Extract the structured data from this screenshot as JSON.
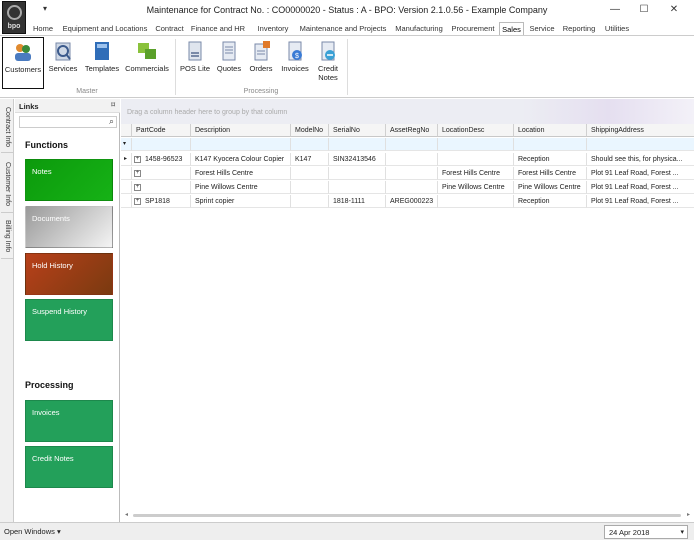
{
  "window": {
    "title": "Maintenance for Contract No. : CO0000020 - Status : A - BPO: Version 2.1.0.56 - Example Company",
    "logo_text": "bpo",
    "qat_glyph": "▾",
    "minimize_glyph": "—",
    "maximize_glyph": "☐",
    "close_glyph": "✕"
  },
  "ribbon_tabs": [
    "Home",
    "Equipment and Locations",
    "Contract",
    "Finance and HR",
    "Inventory",
    "Maintenance and Projects",
    "Manufacturing",
    "Procurement",
    "Sales",
    "Service",
    "Reporting",
    "Utilities"
  ],
  "ribbon_active_tab": "Sales",
  "ribbon": {
    "master": {
      "label": "Master",
      "buttons": [
        "Customers",
        "Services",
        "Templates",
        "Commercials"
      ]
    },
    "processing": {
      "label": "Processing",
      "buttons": [
        "POS Lite",
        "Quotes",
        "Orders",
        "Invoices",
        "Credit Notes"
      ]
    }
  },
  "side_tabs": [
    "Contract Info",
    "Customer Info",
    "Billing Info"
  ],
  "links": {
    "header": "Links",
    "pin_glyph": "⌑",
    "search_glyph": "⌕",
    "functions_title": "Functions",
    "functions": [
      "Notes",
      "Documents",
      "Hold History",
      "Suspend History"
    ],
    "processing_title": "Processing",
    "processing": [
      "Invoices",
      "Credit Notes"
    ],
    "colors": {
      "green": "#23a05a",
      "notes_green": "#14a514",
      "documents_gray": "#a8a8a8",
      "hold_rust": "#c3501a"
    }
  },
  "grid": {
    "group_hint": "Drag a column header here to group by that column",
    "filter_glyph": "▾",
    "columns": [
      "PartCode",
      "Description",
      "ModelNo",
      "SerialNo",
      "AssetRegNo",
      "LocationDesc",
      "Location",
      "ShippingAddress"
    ],
    "rows": [
      {
        "PartCode": "1458-96523",
        "Description": "K147 Kyocera Colour Copier",
        "ModelNo": "K147",
        "SerialNo": "SIN32413546",
        "AssetRegNo": "",
        "LocationDesc": "",
        "Location": "Reception",
        "ShippingAddress": "Should see this, for physica..."
      },
      {
        "PartCode": "",
        "Description": "Forest Hills Centre",
        "ModelNo": "",
        "SerialNo": "",
        "AssetRegNo": "",
        "LocationDesc": "Forest Hills Centre",
        "Location": "Forest Hills Centre",
        "ShippingAddress": "Plot 91 Leaf Road, Forest ..."
      },
      {
        "PartCode": "",
        "Description": "Pine Willows Centre",
        "ModelNo": "",
        "SerialNo": "",
        "AssetRegNo": "",
        "LocationDesc": "Pine Willows Centre",
        "Location": "Pine Willows Centre",
        "ShippingAddress": "Plot 91 Leaf Road, Forest ..."
      },
      {
        "PartCode": "SP1818",
        "Description": "Sprint copier",
        "ModelNo": "",
        "SerialNo": "1818-1111",
        "AssetRegNo": "AREG000223",
        "LocationDesc": "",
        "Location": "Reception",
        "ShippingAddress": "Plot 91 Leaf Road, Forest ..."
      }
    ],
    "current_row_glyph": "▸",
    "expand_glyph": "+"
  },
  "statusbar": {
    "open_windows": "Open Windows ▾",
    "date": "24 Apr 2018",
    "date_glyph": "▾"
  }
}
